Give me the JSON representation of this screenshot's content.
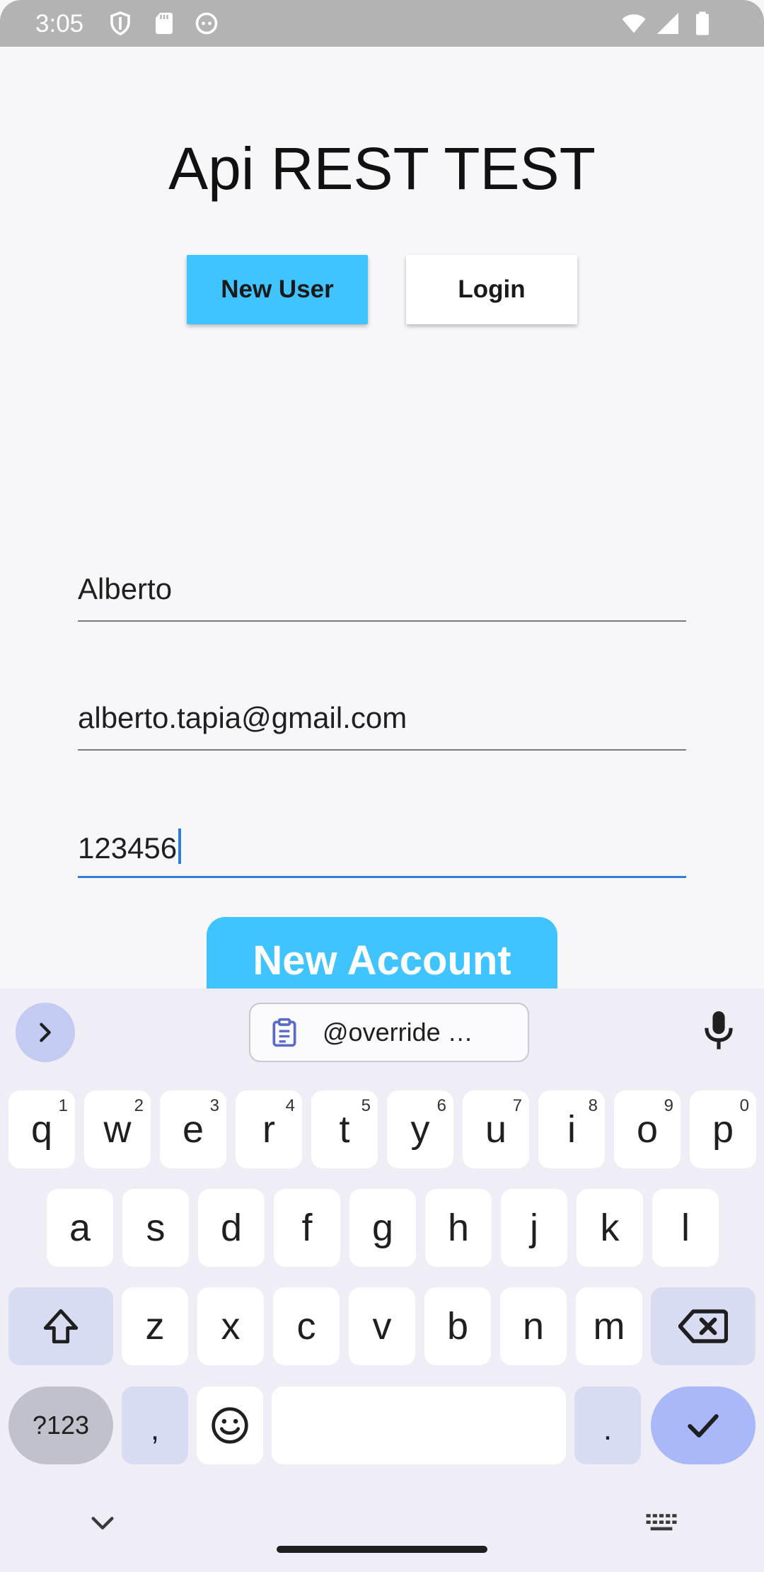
{
  "status_bar": {
    "time": "3:05",
    "icons": [
      "shield-icon",
      "sd-card-icon",
      "android-icon",
      "wifi-icon",
      "signal-icon",
      "battery-icon"
    ]
  },
  "app": {
    "title": "Api REST TEST",
    "tabs": [
      {
        "label": "New User",
        "selected": true
      },
      {
        "label": "Login",
        "selected": false
      }
    ],
    "fields": [
      {
        "name": "name",
        "value": "Alberto"
      },
      {
        "name": "email",
        "value": "alberto.tapia@gmail.com"
      },
      {
        "name": "password",
        "value": "123456",
        "focused": true
      }
    ],
    "submit_label": "New Account",
    "accent_color": "#40c4ff"
  },
  "keyboard": {
    "clipboard_suggestion": "@override   …",
    "row1": [
      {
        "k": "q",
        "s": "1"
      },
      {
        "k": "w",
        "s": "2"
      },
      {
        "k": "e",
        "s": "3"
      },
      {
        "k": "r",
        "s": "4"
      },
      {
        "k": "t",
        "s": "5"
      },
      {
        "k": "y",
        "s": "6"
      },
      {
        "k": "u",
        "s": "7"
      },
      {
        "k": "i",
        "s": "8"
      },
      {
        "k": "o",
        "s": "9"
      },
      {
        "k": "p",
        "s": "0"
      }
    ],
    "row2": [
      "a",
      "s",
      "d",
      "f",
      "g",
      "h",
      "j",
      "k",
      "l"
    ],
    "row3": [
      "z",
      "x",
      "c",
      "v",
      "b",
      "n",
      "m"
    ],
    "symbols_label": "?123",
    "comma_label": ",",
    "period_label": "."
  }
}
